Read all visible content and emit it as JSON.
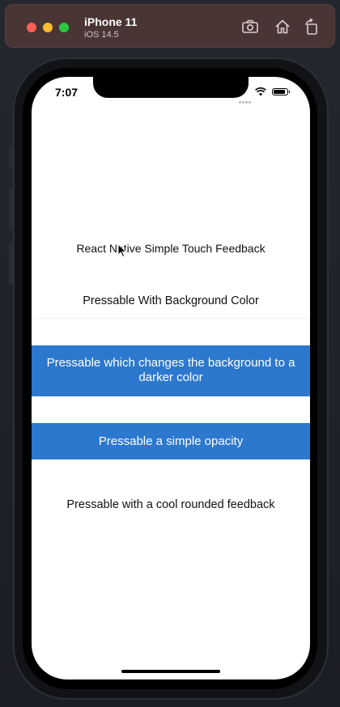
{
  "simulator": {
    "device_name": "iPhone 11",
    "os_version": "iOS 14.5",
    "toolbar_icons": [
      "screenshot-icon",
      "home-icon",
      "rotate-icon"
    ]
  },
  "status_bar": {
    "time": "7:07",
    "battery_level": 0.9
  },
  "app": {
    "title": "React Native Simple Touch Feedback",
    "buttons": [
      {
        "label": "Pressable With Background Color",
        "style": "plain"
      },
      {
        "label": "Pressable which changes the background to a darker color",
        "style": "filled"
      },
      {
        "label": "Pressable a simple opacity",
        "style": "filled"
      },
      {
        "label": "Pressable with a cool rounded feedback",
        "style": "plain"
      }
    ]
  },
  "colors": {
    "accent": "#2d78cf",
    "screen_background": "#ffffff",
    "titlebar": "#4a3535"
  }
}
